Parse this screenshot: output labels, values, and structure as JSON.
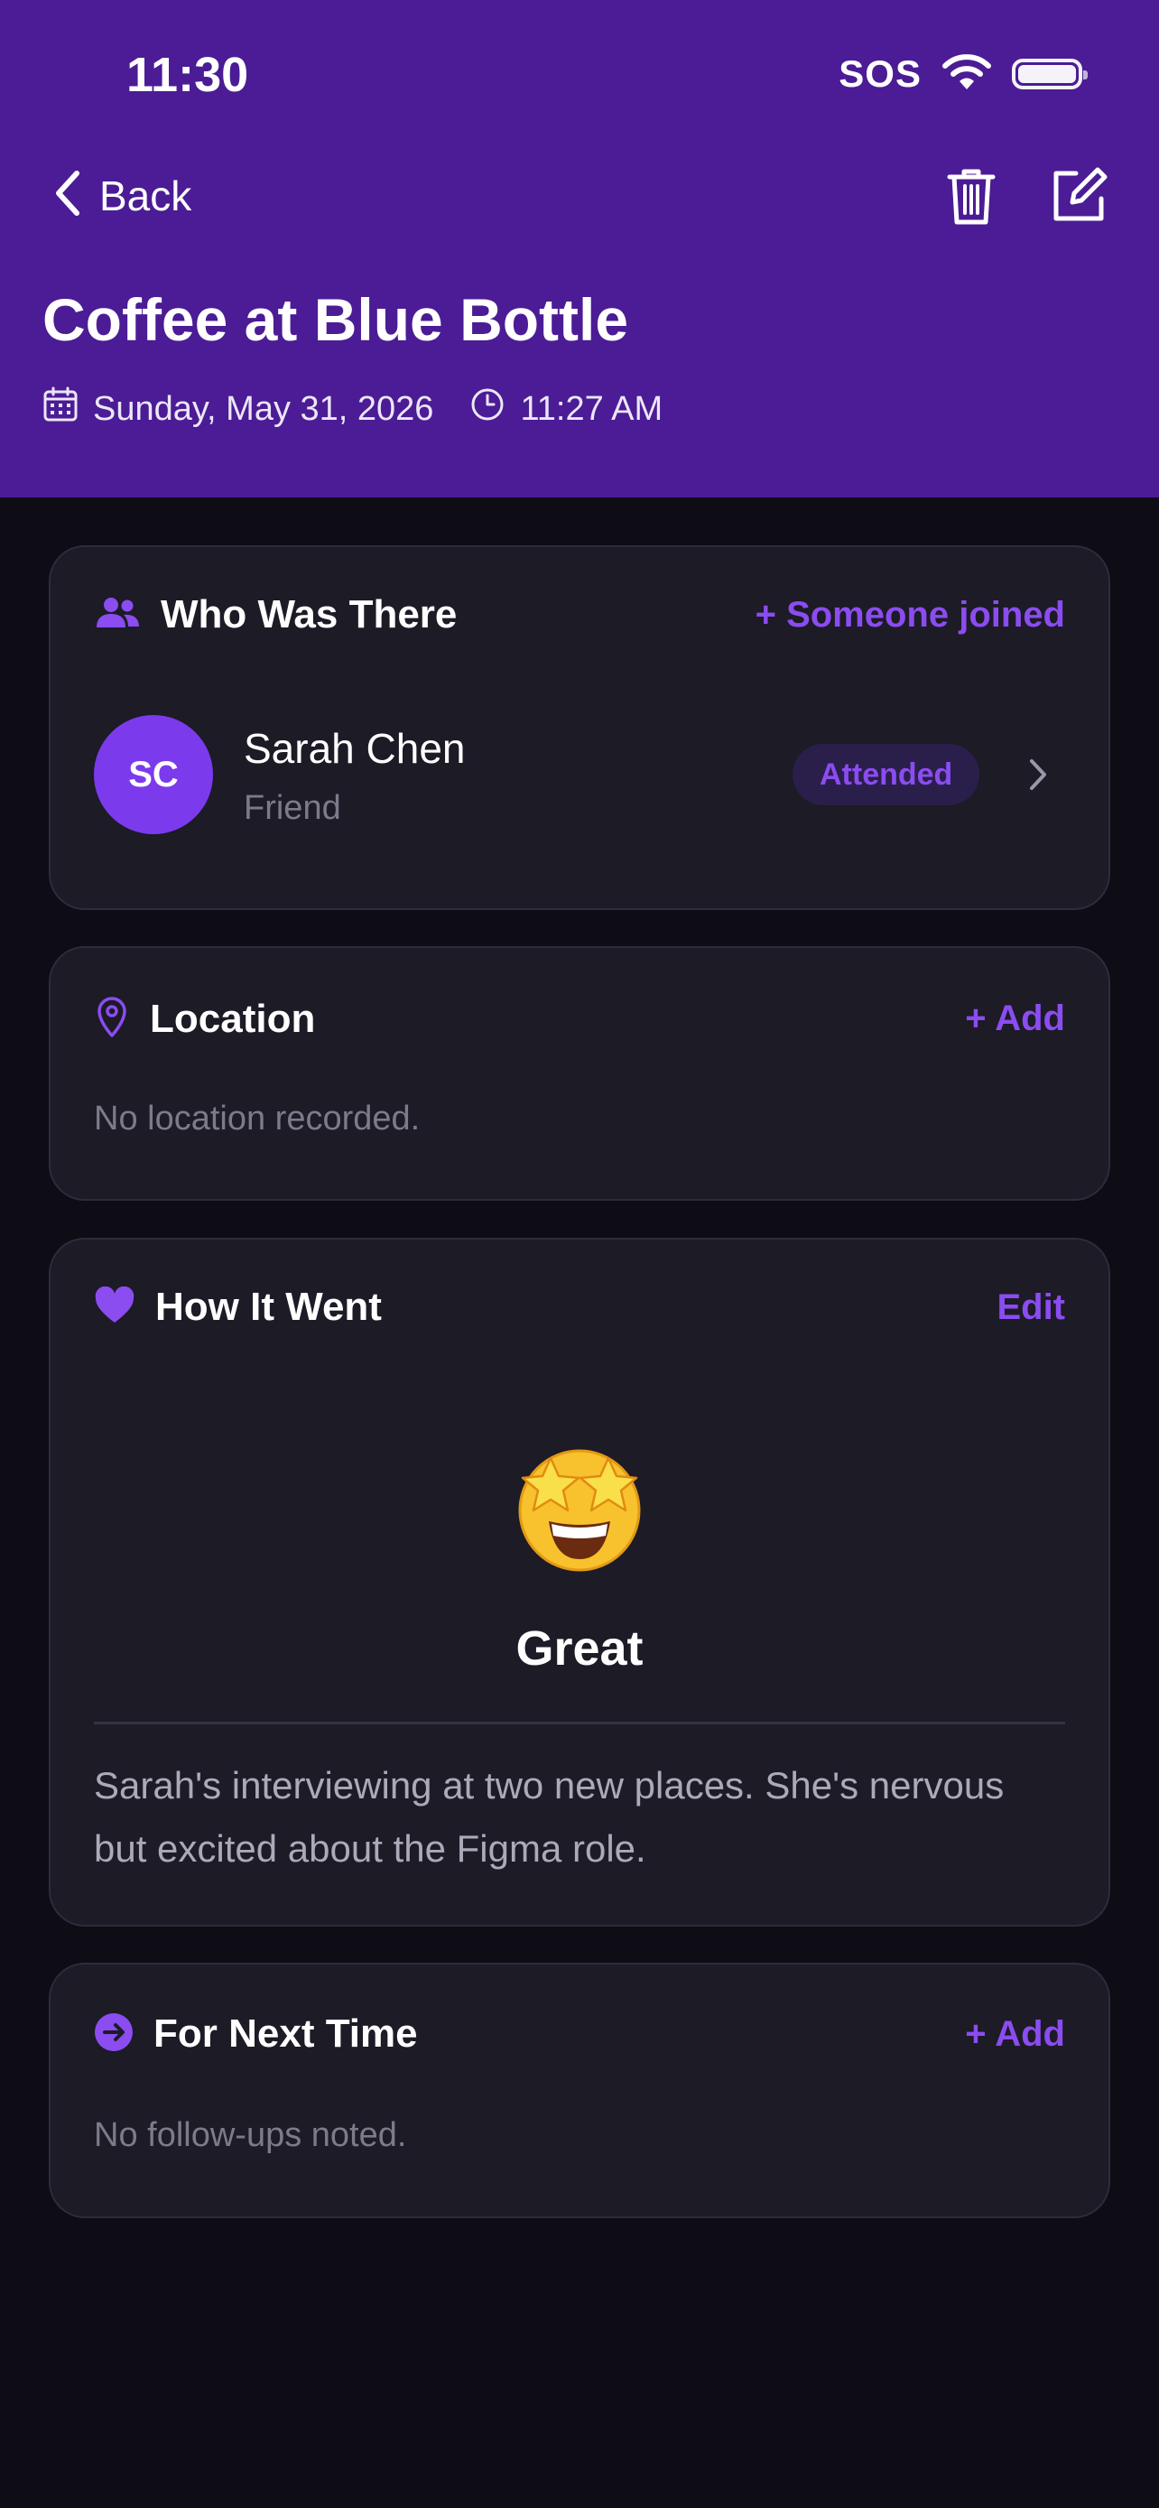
{
  "status_bar": {
    "time": "11:30",
    "carrier": "SOS"
  },
  "nav": {
    "back_label": "Back"
  },
  "event": {
    "title": "Coffee at Blue Bottle",
    "date": "Sunday, May 31, 2026",
    "time": "11:27 AM"
  },
  "who": {
    "title": "Who Was There",
    "action": "+ Someone joined",
    "people": [
      {
        "initials": "SC",
        "name": "Sarah Chen",
        "relation": "Friend",
        "status": "Attended"
      }
    ]
  },
  "location": {
    "title": "Location",
    "action": "+ Add",
    "empty": "No location recorded."
  },
  "how": {
    "title": "How It Went",
    "action": "Edit",
    "emoji": "🤩",
    "rating": "Great",
    "notes": "Sarah's interviewing at two new places. She's nervous but excited about the Figma role."
  },
  "next": {
    "title": "For Next Time",
    "action": "+ Add",
    "empty": "No follow-ups noted."
  },
  "colors": {
    "header": "#4b1c95",
    "accent": "#8b4cf0",
    "avatar": "#7c3aed",
    "background": "#0e0d16",
    "card": "#1c1b26"
  }
}
